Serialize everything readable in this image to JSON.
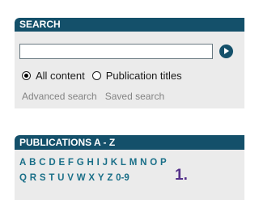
{
  "search": {
    "header": "SEARCH",
    "input_value": "",
    "input_placeholder": "",
    "options": [
      {
        "label": "All content",
        "checked": true
      },
      {
        "label": "Publication titles",
        "checked": false
      }
    ],
    "links": [
      "Advanced search",
      "Saved search"
    ]
  },
  "publications": {
    "header": "PUBLICATIONS A - Z",
    "row1": [
      "A",
      "B",
      "C",
      "D",
      "E",
      "F",
      "G",
      "H",
      "I",
      "J",
      "K",
      "L",
      "M",
      "N",
      "O",
      "P"
    ],
    "row2": [
      "Q",
      "R",
      "S",
      "T",
      "U",
      "V",
      "W",
      "X",
      "Y",
      "Z",
      "0-9"
    ],
    "marker": "1."
  },
  "colors": {
    "header_bg": "#14506a",
    "panel_bg": "#ebebeb",
    "letter_color": "#1a6f88",
    "link_color": "#848484",
    "marker_color": "#54308a"
  }
}
